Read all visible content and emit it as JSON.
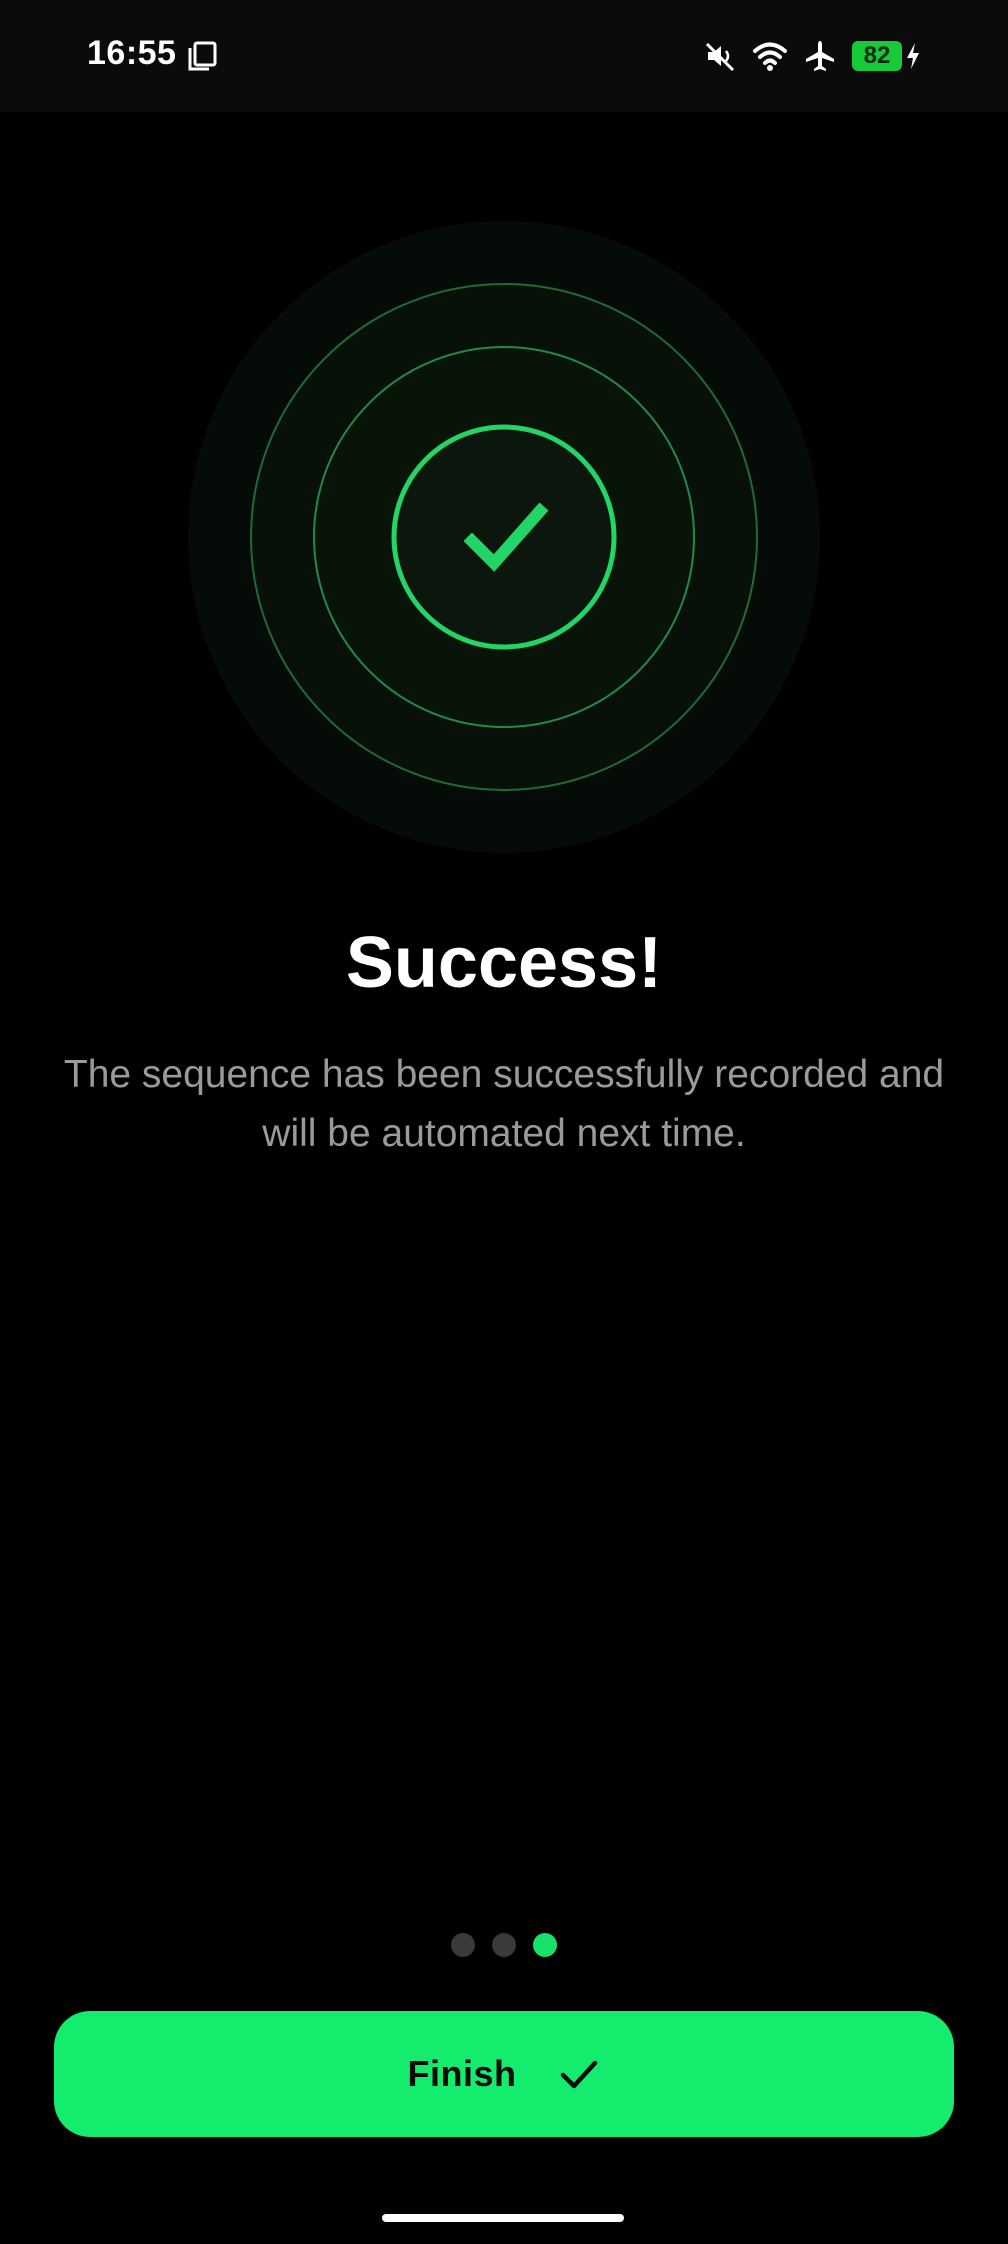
{
  "status_bar": {
    "time": "16:55",
    "battery_level": "82",
    "icons": [
      "screenshot-icon",
      "mute-icon",
      "wifi-icon",
      "airplane-icon",
      "battery-icon",
      "charging-bolt-icon"
    ]
  },
  "success_graphic": {
    "icon": "checkmark-icon",
    "accent_color": "#22d566"
  },
  "content": {
    "title": "Success!",
    "subtitle": "The sequence has been successfully recorded and will be automated next time."
  },
  "pager": {
    "total": 3,
    "active_index": 2
  },
  "footer": {
    "finish_label": "Finish",
    "finish_icon": "checkmark-icon",
    "button_color": "#13ec6d"
  }
}
